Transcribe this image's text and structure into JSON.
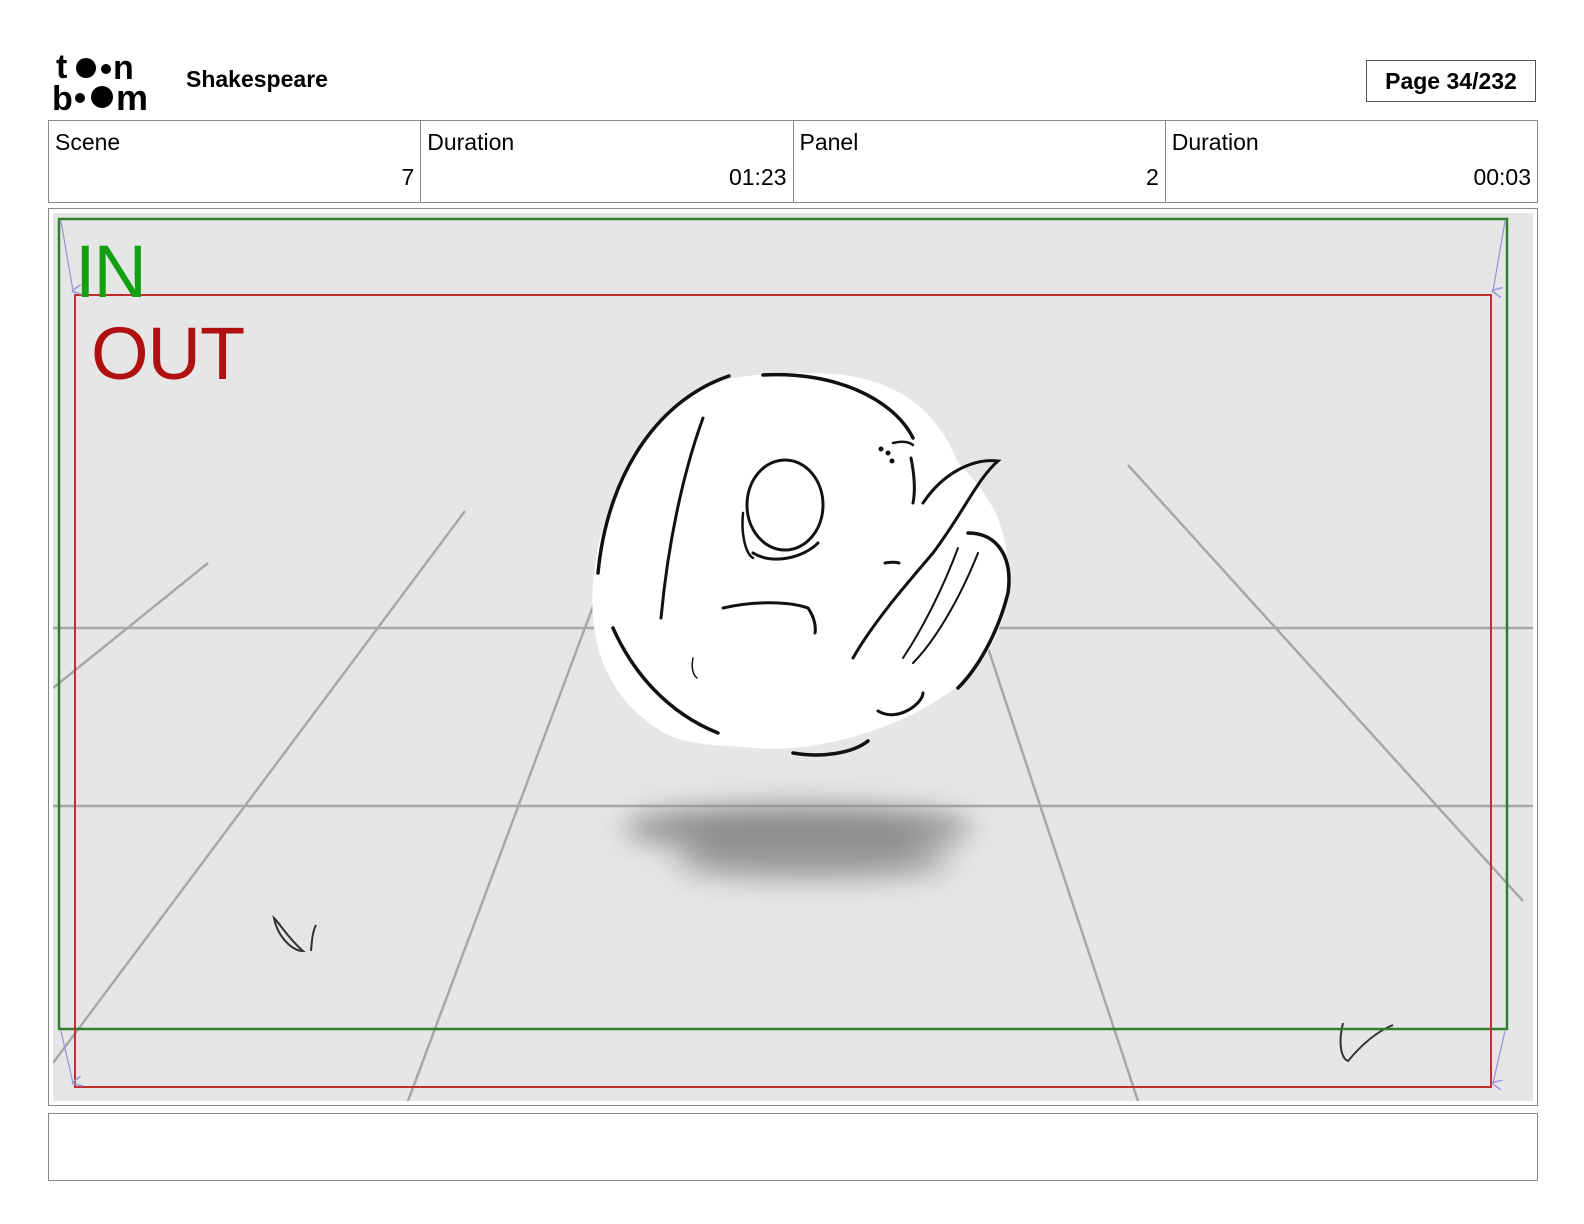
{
  "header": {
    "logo_icon": "toonboom-logo-icon",
    "project_title": "Shakespeare",
    "page_label": "Page",
    "page_number": "34/232"
  },
  "info": [
    {
      "label": "Scene",
      "value": "7"
    },
    {
      "label": "Duration",
      "value": "01:23"
    },
    {
      "label": "Panel",
      "value": "2"
    },
    {
      "label": "Duration",
      "value": "00:03"
    }
  ],
  "panel": {
    "in_label": "IN",
    "out_label": "OUT",
    "in_color": "#12a012",
    "out_color": "#b01010"
  },
  "notes": {
    "text": ""
  }
}
